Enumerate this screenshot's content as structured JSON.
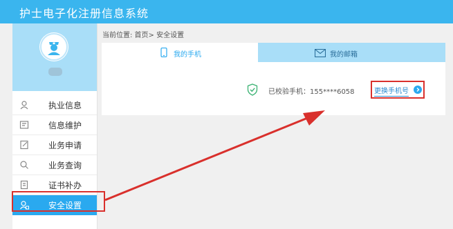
{
  "app": {
    "title": "护士电子化注册信息系统"
  },
  "breadcrumb": {
    "text": "当前位置: 首页> 安全设置"
  },
  "sidebar": {
    "items": [
      {
        "label": "执业信息",
        "icon": "id-card-icon",
        "active": false
      },
      {
        "label": "信息维护",
        "icon": "edit-info-icon",
        "active": false
      },
      {
        "label": "业务申请",
        "icon": "apply-form-icon",
        "active": false
      },
      {
        "label": "业务查询",
        "icon": "query-icon",
        "active": false
      },
      {
        "label": "证书补办",
        "icon": "certificate-icon",
        "active": false
      },
      {
        "label": "安全设置",
        "icon": "user-lock-icon",
        "active": true
      }
    ]
  },
  "tabs": {
    "phone": {
      "label": "我的手机",
      "icon": "phone-icon"
    },
    "email": {
      "label": "我的邮箱",
      "icon": "mail-icon"
    }
  },
  "security": {
    "verified_text": "已校验手机：155****6058",
    "change_label": "更换手机号"
  },
  "colors": {
    "header": "#3ab5ee",
    "active_item": "#2aa9ef",
    "tab_inactive": "#a9def8",
    "annotation": "#d9302c"
  }
}
